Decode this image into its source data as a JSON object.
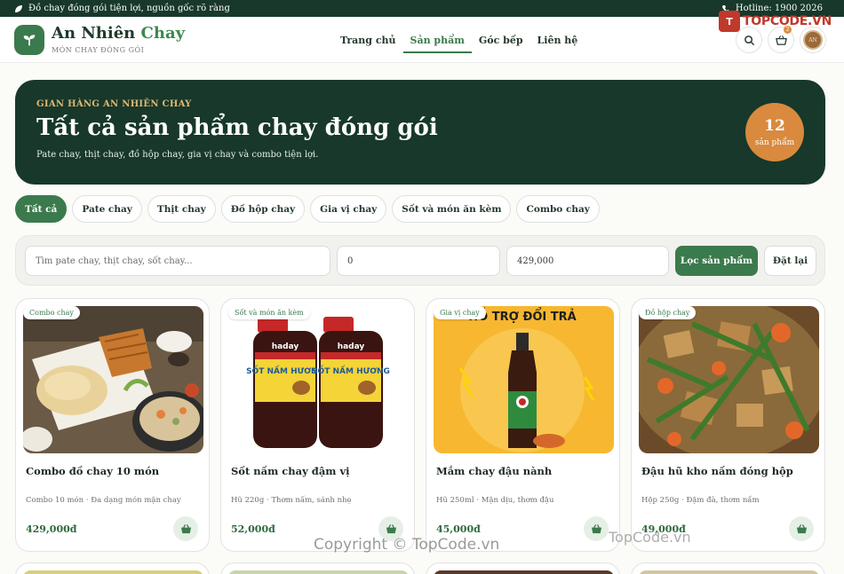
{
  "topbar": {
    "tagline": "Đồ chay đóng gói tiện lợi, nguồn gốc rõ ràng",
    "hotline": "Hotline: 1900 2026"
  },
  "brand": {
    "name_main": "An Nhiên",
    "name_accent": "Chay",
    "tagline": "MÓN CHAY ĐÓNG GÓI"
  },
  "nav": [
    {
      "label": "Trang chủ",
      "active": false
    },
    {
      "label": "Sản phẩm",
      "active": true
    },
    {
      "label": "Góc bếp",
      "active": false
    },
    {
      "label": "Liên hệ",
      "active": false
    }
  ],
  "header_actions": {
    "cart_count": "2",
    "avatar_initials": "AN"
  },
  "watermark": {
    "logo_mark": "T",
    "logo_text": "TOPCODE.VN",
    "copyright": "Copyright © TopCode.vn",
    "site": "TopCode.vn"
  },
  "hero": {
    "eyebrow": "GIAN HÀNG AN NHIÊN CHAY",
    "title": "Tất cả sản phẩm chay đóng gói",
    "subtitle": "Pate chay, thịt chay, đồ hộp chay, gia vị chay và combo tiện lợi.",
    "count": "12",
    "count_label": "sản phẩm"
  },
  "filters": [
    {
      "label": "Tất cả",
      "active": true
    },
    {
      "label": "Pate chay",
      "active": false
    },
    {
      "label": "Thịt chay",
      "active": false
    },
    {
      "label": "Đồ hộp chay",
      "active": false
    },
    {
      "label": "Gia vị chay",
      "active": false
    },
    {
      "label": "Sốt và món ăn kèm",
      "active": false
    },
    {
      "label": "Combo chay",
      "active": false
    }
  ],
  "search": {
    "placeholder": "Tìm pate chay, thịt chay, sốt chay...",
    "min_price": "0",
    "max_price": "429,000",
    "filter_button": "Lọc sản phẩm",
    "reset_button": "Đặt lại"
  },
  "products": [
    {
      "tag": "Combo chay",
      "name": "Combo đồ chay 10 món",
      "desc": "Combo 10 món · Đa dạng món mặn chay",
      "price": "429,000đ"
    },
    {
      "tag": "Sốt và món ăn kèm",
      "name": "Sốt nấm chay đậm vị",
      "desc": "Hũ 220g · Thơm nấm, sánh nhẹ",
      "price": "52,000đ",
      "jar_brand": "haday",
      "jar_label": "SỐT NẤM HƯƠNG"
    },
    {
      "tag": "Gia vị chay",
      "name": "Mắm chay đậu nành",
      "desc": "Hũ 250ml · Mặn dịu, thơm đậu",
      "price": "45,000đ",
      "banner": "HỖ TRỢ ĐỔI TRẢ"
    },
    {
      "tag": "Đồ hộp chay",
      "name": "Đậu hũ kho nấm đóng hộp",
      "desc": "Hộp 250g · Đậm đà, thơm nấm",
      "price": "49,000đ"
    }
  ],
  "colors": {
    "primary": "#3b7a4c",
    "dark": "#17382a",
    "accent": "#d98a3e"
  }
}
